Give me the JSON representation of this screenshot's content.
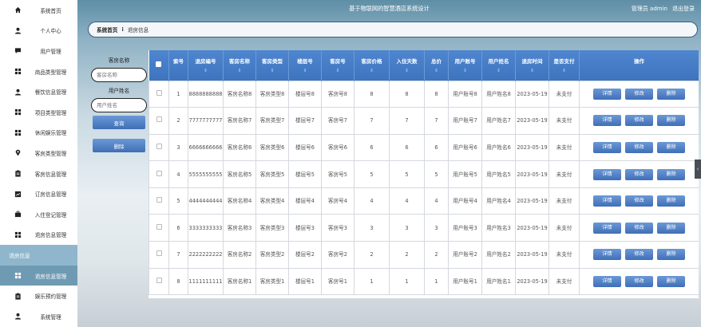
{
  "app": {
    "title": "基于物联网的智慧酒店系统设计",
    "user_label": "管理员 admin",
    "logout": "退出登录"
  },
  "sidebar": {
    "items": [
      {
        "label": "系统首页",
        "icon": "home-icon"
      },
      {
        "label": "个人中心",
        "icon": "person-icon"
      },
      {
        "label": "用户管理",
        "icon": "chat-icon"
      },
      {
        "label": "商品类型管理",
        "icon": "grid-icon"
      },
      {
        "label": "餐饮信息管理",
        "icon": "person-icon"
      },
      {
        "label": "项目类型管理",
        "icon": "grid-icon"
      },
      {
        "label": "休闲娱乐管理",
        "icon": "grid-icon"
      },
      {
        "label": "客房类型管理",
        "icon": "location-icon"
      },
      {
        "label": "客房信息管理",
        "icon": "clipboard-icon"
      },
      {
        "label": "订房信息管理",
        "icon": "chart-icon"
      },
      {
        "label": "入住登记管理",
        "icon": "briefcase-icon"
      },
      {
        "label": "退房信息管理",
        "icon": "grid-icon"
      },
      {
        "label": "退房信息",
        "icon": ""
      },
      {
        "label": "退房信息管理",
        "icon": "grid-icon"
      },
      {
        "label": "娱乐预约管理",
        "icon": "clipboard-icon"
      },
      {
        "label": "系统管理",
        "icon": "person-icon"
      }
    ]
  },
  "breadcrumb": {
    "home": "系统首页",
    "separator": "⁝",
    "current": "退房信息"
  },
  "search": {
    "room_name_label": "客房名称",
    "room_name_placeholder": "客房名称",
    "user_name_label": "用户姓名",
    "user_name_placeholder": "用户姓名",
    "query_button": "查询",
    "delete_button": "删除"
  },
  "table": {
    "columns": [
      "索号",
      "退房编号",
      "客房名称",
      "客房类型",
      "楼层号",
      "客房号",
      "客房价格",
      "入住天数",
      "总价",
      "用户账号",
      "用户姓名",
      "退房时间",
      "是否支付",
      "操作"
    ],
    "sort_glyph": "⇕",
    "actions": {
      "detail": "详情",
      "edit": "修改",
      "delete": "删除"
    },
    "rows": [
      {
        "no": "1",
        "code": "8888888888",
        "room_name": "客房名称8",
        "room_type": "客房类型8",
        "floor": "楼层号8",
        "room_no": "客房号8",
        "price": "8",
        "days": "8",
        "total": "8",
        "account": "用户账号8",
        "user_name": "用户姓名8",
        "time": "2023-05-19",
        "paid": "未支付"
      },
      {
        "no": "2",
        "code": "7777777777",
        "room_name": "客房名称7",
        "room_type": "客房类型7",
        "floor": "楼层号7",
        "room_no": "客房号7",
        "price": "7",
        "days": "7",
        "total": "7",
        "account": "用户账号7",
        "user_name": "用户姓名7",
        "time": "2023-05-19",
        "paid": "未支付"
      },
      {
        "no": "3",
        "code": "6666666666",
        "room_name": "客房名称6",
        "room_type": "客房类型6",
        "floor": "楼层号6",
        "room_no": "客房号6",
        "price": "6",
        "days": "6",
        "total": "6",
        "account": "用户账号6",
        "user_name": "用户姓名6",
        "time": "2023-05-19",
        "paid": "未支付"
      },
      {
        "no": "4",
        "code": "5555555555",
        "room_name": "客房名称5",
        "room_type": "客房类型5",
        "floor": "楼层号5",
        "room_no": "客房号5",
        "price": "5",
        "days": "5",
        "total": "5",
        "account": "用户账号5",
        "user_name": "用户姓名5",
        "time": "2023-05-19",
        "paid": "未支付"
      },
      {
        "no": "5",
        "code": "4444444444",
        "room_name": "客房名称4",
        "room_type": "客房类型4",
        "floor": "楼层号4",
        "room_no": "客房号4",
        "price": "4",
        "days": "4",
        "total": "4",
        "account": "用户账号4",
        "user_name": "用户姓名4",
        "time": "2023-05-19",
        "paid": "未支付"
      },
      {
        "no": "6",
        "code": "3333333333",
        "room_name": "客房名称3",
        "room_type": "客房类型3",
        "floor": "楼层号3",
        "room_no": "客房号3",
        "price": "3",
        "days": "3",
        "total": "3",
        "account": "用户账号3",
        "user_name": "用户姓名3",
        "time": "2023-05-19",
        "paid": "未支付"
      },
      {
        "no": "7",
        "code": "2222222222",
        "room_name": "客房名称2",
        "room_type": "客房类型2",
        "floor": "楼层号2",
        "room_no": "客房号2",
        "price": "2",
        "days": "2",
        "total": "2",
        "account": "用户账号2",
        "user_name": "用户姓名2",
        "time": "2023-05-19",
        "paid": "未支付"
      },
      {
        "no": "8",
        "code": "1111111111",
        "room_name": "客房名称1",
        "room_type": "客房类型1",
        "floor": "楼层号1",
        "room_no": "客房号1",
        "price": "1",
        "days": "1",
        "total": "1",
        "account": "用户账号1",
        "user_name": "用户姓名1",
        "time": "2023-05-19",
        "paid": "未支付"
      }
    ]
  },
  "edge_tab": {
    "glyph": "‹"
  }
}
